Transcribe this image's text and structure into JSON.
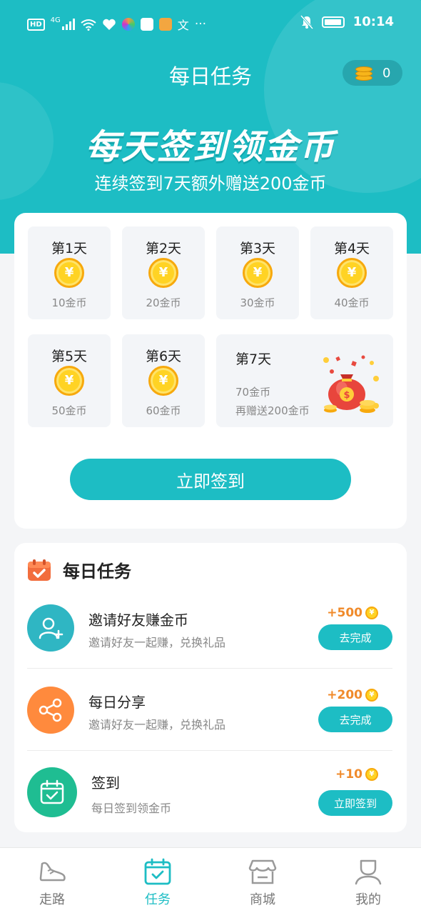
{
  "status_bar": {
    "network": "4G",
    "time": "10:14",
    "more": "···"
  },
  "header": {
    "title": "每日任务",
    "coin_balance": "0"
  },
  "hero": {
    "banner": "每天签到领金币",
    "subtitle": "连续签到7天额外赠送200金币"
  },
  "checkin": {
    "days": [
      {
        "label": "第1天",
        "reward": "10金币"
      },
      {
        "label": "第2天",
        "reward": "20金币"
      },
      {
        "label": "第3天",
        "reward": "30金币"
      },
      {
        "label": "第4天",
        "reward": "40金币"
      },
      {
        "label": "第5天",
        "reward": "50金币"
      },
      {
        "label": "第6天",
        "reward": "60金币"
      }
    ],
    "day7": {
      "label": "第7天",
      "reward": "70金币",
      "bonus": "再赠送200金币"
    },
    "coin_symbol": "¥",
    "button_label": "立即签到"
  },
  "tasks": {
    "title": "每日任务",
    "items": [
      {
        "name": "邀请好友赚金币",
        "desc": "邀请好友一起赚，兑换礼品",
        "bonus": "+500",
        "action": "去完成",
        "icon": "add-user-icon",
        "color": "#2fb6c3"
      },
      {
        "name": "每日分享",
        "desc": "邀请好友一起赚，兑换礼品",
        "bonus": "+200",
        "action": "去完成",
        "icon": "share-icon",
        "color": "#ff8a3d"
      },
      {
        "name": "签到",
        "desc": "每日签到领金币",
        "bonus": "+10",
        "action": "立即签到",
        "icon": "calendar-check-icon",
        "color": "#1fbd92"
      }
    ]
  },
  "tabbar": {
    "items": [
      {
        "label": "走路",
        "icon": "shoe-icon",
        "active": false
      },
      {
        "label": "任务",
        "icon": "calendar-check-icon",
        "active": true
      },
      {
        "label": "商城",
        "icon": "store-icon",
        "active": false
      },
      {
        "label": "我的",
        "icon": "user-icon",
        "active": false
      }
    ]
  },
  "colors": {
    "primary": "#1dbdc4",
    "bonus": "#f08a2a",
    "coin": "#ffd324"
  }
}
